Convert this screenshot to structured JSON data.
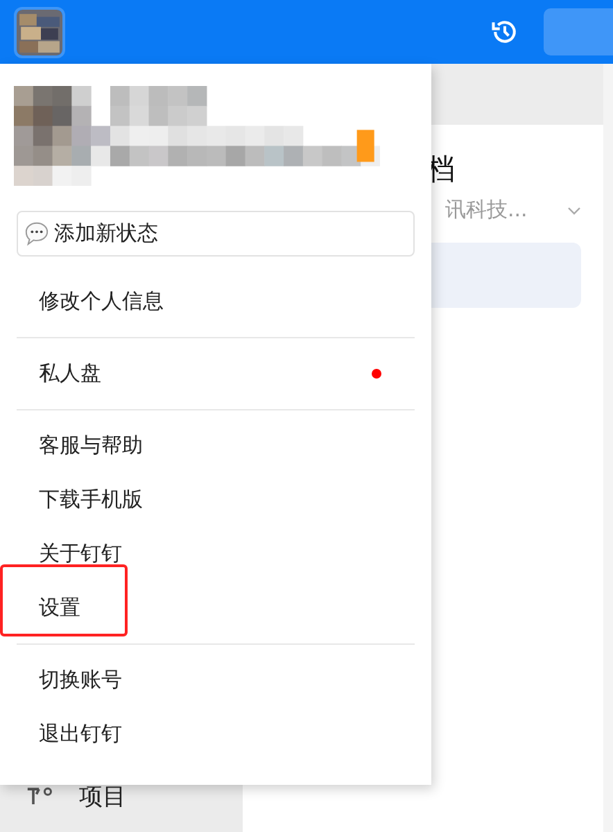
{
  "background": {
    "title_fragment": "档",
    "subtitle": "讯科技...",
    "sidebar_item": "项目"
  },
  "menu": {
    "status_button": "添加新状态",
    "items": [
      {
        "label": "修改个人信息",
        "divider_before": false,
        "dot": false,
        "highlighted": false
      },
      {
        "label": "私人盘",
        "divider_before": true,
        "dot": true,
        "highlighted": false
      },
      {
        "label": "客服与帮助",
        "divider_before": true,
        "dot": false,
        "highlighted": false
      },
      {
        "label": "下载手机版",
        "divider_before": false,
        "dot": false,
        "highlighted": false
      },
      {
        "label": "关于钉钉",
        "divider_before": false,
        "dot": false,
        "highlighted": false
      },
      {
        "label": "设置",
        "divider_before": false,
        "dot": false,
        "highlighted": true
      },
      {
        "label": "切换账号",
        "divider_before": true,
        "dot": false,
        "highlighted": false
      },
      {
        "label": "退出钉钉",
        "divider_before": false,
        "dot": false,
        "highlighted": false
      }
    ]
  }
}
